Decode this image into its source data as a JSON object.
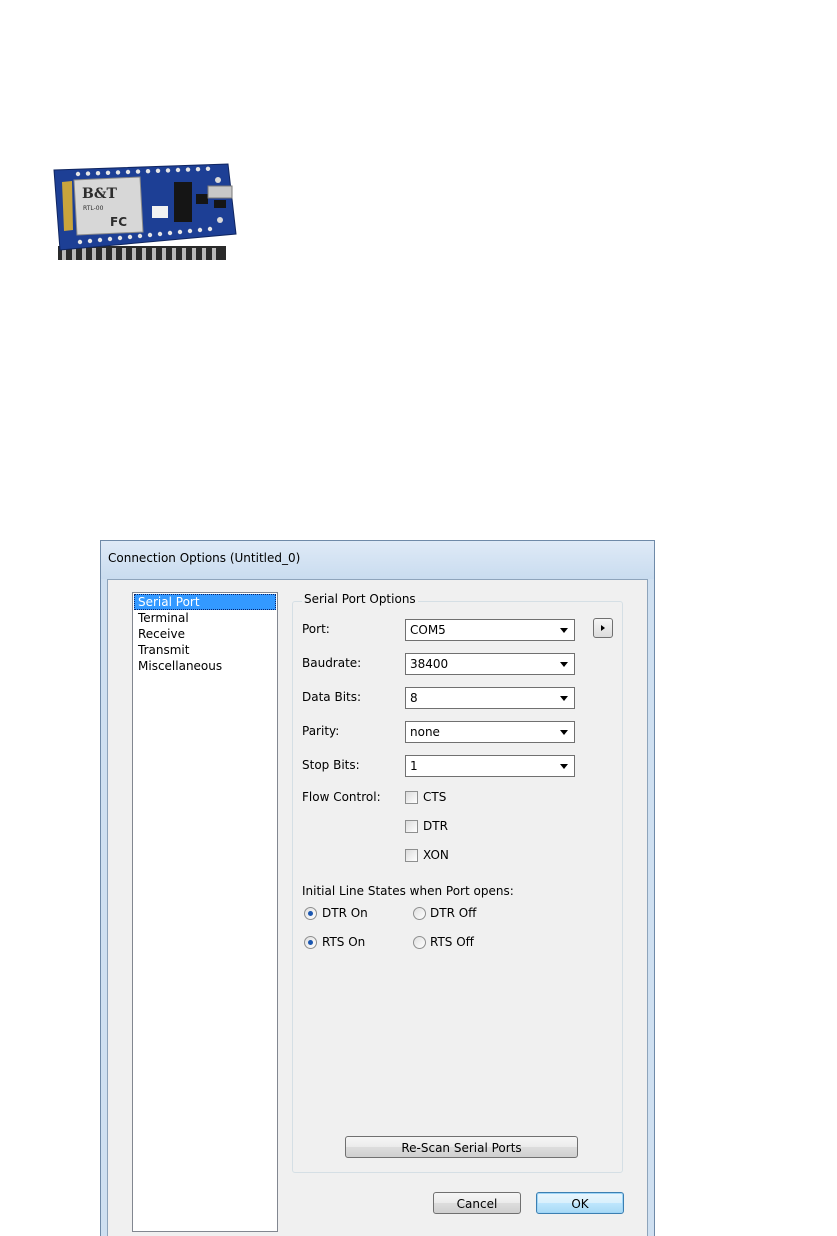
{
  "board_image": {
    "label_top": "B&T",
    "label_model": "RTL-00",
    "label_fc": "FC"
  },
  "dialog": {
    "title": "Connection Options (Untitled_0)",
    "nav": [
      {
        "label": "Serial Port",
        "selected": true
      },
      {
        "label": "Terminal",
        "selected": false
      },
      {
        "label": "Receive",
        "selected": false
      },
      {
        "label": "Transmit",
        "selected": false
      },
      {
        "label": "Miscellaneous",
        "selected": false
      }
    ],
    "group_title": "Serial Port Options",
    "fields": {
      "port": {
        "label": "Port:",
        "value": "COM5"
      },
      "baudrate": {
        "label": "Baudrate:",
        "value": "38400"
      },
      "data_bits": {
        "label": "Data Bits:",
        "value": "8"
      },
      "parity": {
        "label": "Parity:",
        "value": "none"
      },
      "stop_bits": {
        "label": "Stop Bits:",
        "value": "1"
      }
    },
    "flow_control": {
      "label": "Flow Control:",
      "options": [
        {
          "label": "CTS",
          "checked": false
        },
        {
          "label": "DTR",
          "checked": false
        },
        {
          "label": "XON",
          "checked": false
        }
      ]
    },
    "line_states": {
      "label": "Initial Line States when Port opens:",
      "dtr_on": "DTR On",
      "dtr_off": "DTR Off",
      "rts_on": "RTS On",
      "rts_off": "RTS Off",
      "dtr_selected": "DTR On",
      "rts_selected": "RTS On"
    },
    "rescan_label": "Re-Scan Serial Ports",
    "cancel_label": "Cancel",
    "ok_label": "OK"
  },
  "colors": {
    "selection": "#3399ff",
    "title_bar": "#cfe0f1",
    "radio_dot": "#1a56b0"
  }
}
